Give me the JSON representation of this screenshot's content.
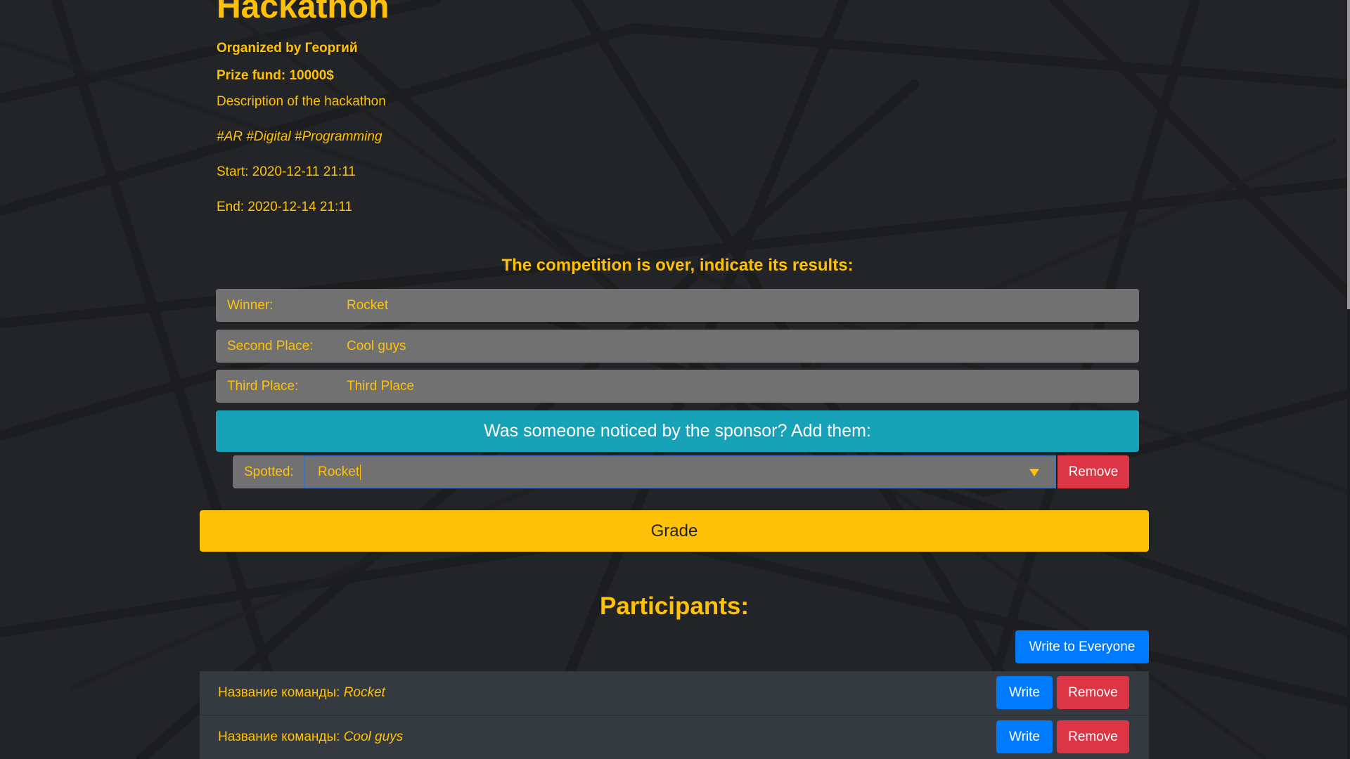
{
  "hackathon": {
    "title": "Hackathon",
    "organizer": "Organized by Георгий",
    "prize": "Prize fund: 10000$",
    "description": "Description of the hackathon",
    "tags": "#AR #Digital #Programming",
    "start": "Start: 2020-12-11 21:11",
    "end": "End: 2020-12-14 21:11"
  },
  "results": {
    "heading": "The competition is over, indicate its results:",
    "winner_label": "Winner:",
    "winner_value": "Rocket",
    "second_label": "Second Place:",
    "second_value": "Cool guys",
    "third_label": "Third Place:",
    "third_value": "Third Place"
  },
  "sponsor": {
    "banner": "Was someone noticed by the sponsor? Add them:",
    "spotted_label": "Spotted:",
    "spotted_value": "Rocket",
    "remove_label": "Remove"
  },
  "grade_label": "Grade",
  "participants": {
    "heading": "Participants:",
    "write_everyone_label": "Write to Everyone",
    "team_prefix": "Название команды: ",
    "write_label": "Write",
    "remove_label": "Remove",
    "teams": [
      {
        "name": "Rocket"
      },
      {
        "name": "Cool guys"
      }
    ]
  },
  "colors": {
    "accent": "#ffc107",
    "background": "#232427",
    "info": "#17a2b8",
    "primary": "#007bff",
    "danger": "#dc3545"
  }
}
